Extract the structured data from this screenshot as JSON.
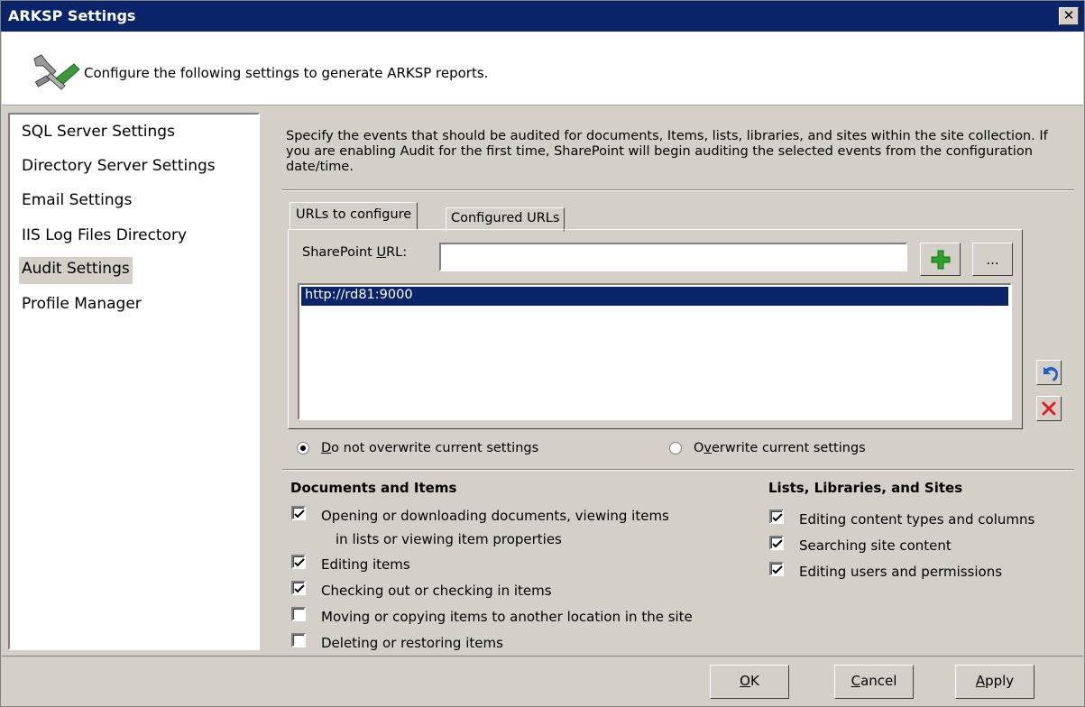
{
  "window": {
    "title": "ARKSP Settings",
    "close_glyph": "✕"
  },
  "header": {
    "text": "Configure the following settings to generate ARKSP reports.",
    "icon": "tools-icon"
  },
  "nav": {
    "items": [
      {
        "label": "SQL Server Settings"
      },
      {
        "label": "Directory Server Settings"
      },
      {
        "label": "Email Settings"
      },
      {
        "label": "IIS Log Files Directory"
      },
      {
        "label": "Audit Settings",
        "selected": true
      },
      {
        "label": "Profile Manager"
      }
    ]
  },
  "main": {
    "description": "Specify the events that should be audited for documents, Items, lists, libraries, and sites within the site collection. If you are enabling Audit for the first time, SharePoint will begin auditing the selected events from the configuration date/time.",
    "tabs": [
      {
        "label": "URLs to configure",
        "active": true
      },
      {
        "label": "Configured URLs",
        "active": false
      }
    ],
    "url_form": {
      "label_pre": "SharePoint ",
      "label_u": "U",
      "label_post": "RL:",
      "value": "",
      "browse_label": "...",
      "list": [
        "http://rd81:9000"
      ]
    },
    "radios": [
      {
        "u": "D",
        "rest": "o not overwrite current settings",
        "selected": true
      },
      {
        "pre": "O",
        "u": "v",
        "rest": "erwrite current settings",
        "selected": false
      }
    ],
    "documents_and_items": {
      "title": "Documents and Items",
      "options": [
        {
          "line1": "Opening or downloading documents, viewing items",
          "line2": "in lists or viewing item properties",
          "checked": true
        },
        {
          "line1": "Editing items",
          "checked": true
        },
        {
          "line1": "Checking out or checking in items",
          "checked": true
        },
        {
          "line1": "Moving or copying items to another location in the site",
          "checked": false
        },
        {
          "line1": "Deleting or restoring items",
          "checked": false
        }
      ]
    },
    "lists_libraries_sites": {
      "title": "Lists, Libraries, and Sites",
      "options": [
        {
          "line1": "Editing content types and columns",
          "checked": true
        },
        {
          "line1": "Searching site content",
          "checked": true
        },
        {
          "line1": "Editing users and permissions",
          "checked": true
        }
      ]
    }
  },
  "footer": {
    "ok": {
      "u": "O",
      "rest": "K"
    },
    "cancel": {
      "u": "C",
      "rest": "ancel"
    },
    "apply": {
      "u": "A",
      "rest": "pply"
    }
  },
  "colors": {
    "titlebar": "#0a246a",
    "face": "#d4d0c8",
    "selection": "#0a246a",
    "add_green": "#2aa52a",
    "delete_red": "#e02020",
    "undo_blue": "#1a5fc8"
  }
}
